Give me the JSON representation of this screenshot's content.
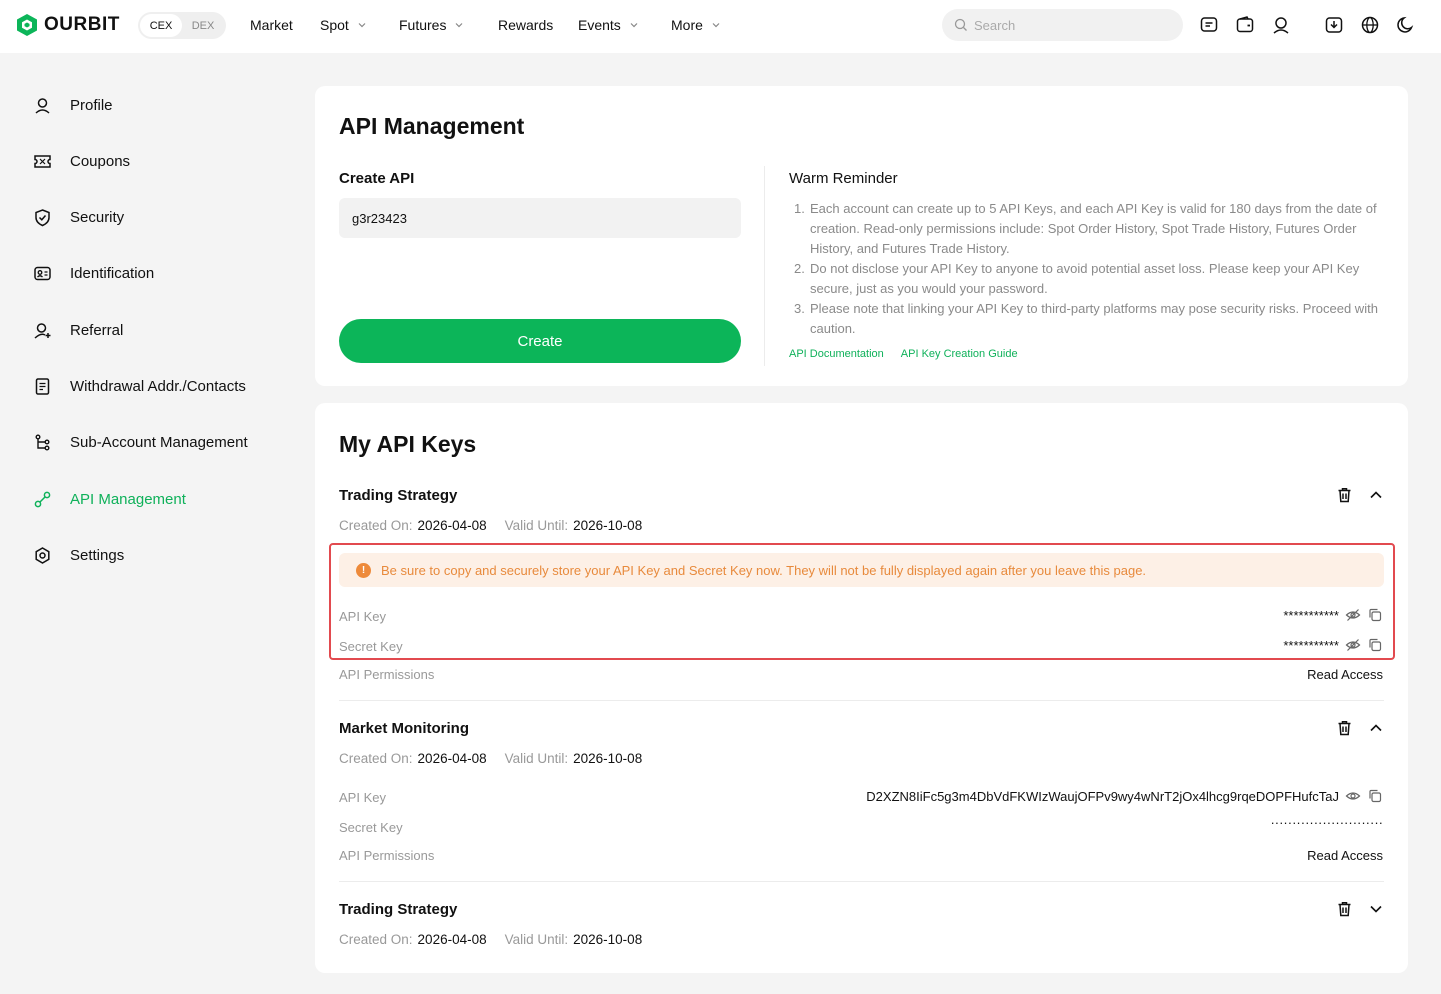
{
  "topbar": {
    "brand": "OURBIT",
    "segments": [
      "CEX",
      "DEX"
    ],
    "nav": [
      "Market",
      "Spot",
      "Futures",
      "Rewards",
      "Events",
      "More"
    ],
    "search_placeholder": "Search"
  },
  "sidebar": {
    "items": [
      {
        "label": "Profile",
        "icon": "user-icon"
      },
      {
        "label": "Coupons",
        "icon": "coupon-icon"
      },
      {
        "label": "Security",
        "icon": "shield-icon"
      },
      {
        "label": "Identification",
        "icon": "id-card-icon"
      },
      {
        "label": "Referral",
        "icon": "user-plus-icon"
      },
      {
        "label": "Withdrawal Addr./Contacts",
        "icon": "document-icon"
      },
      {
        "label": "Sub-Account Management",
        "icon": "branch-icon"
      },
      {
        "label": "API Management",
        "icon": "link-icon"
      },
      {
        "label": "Settings",
        "icon": "settings-icon"
      }
    ],
    "active": "API Management"
  },
  "api": {
    "title": "API Management",
    "create_label": "Create API",
    "create_value": "g3r23423",
    "create_button": "Create",
    "reminder_title": "Warm Reminder",
    "reminders": [
      {
        "num": "1.",
        "text": "Each account can create up to 5 API Keys, and each API Key is valid for 180 days from the date of creation. Read-only permissions include: Spot Order History, Spot Trade History, Futures Order History, and Futures Trade History."
      },
      {
        "num": "2.",
        "text": "Do not disclose your API Key to anyone to avoid potential asset loss. Please keep your API Key secure, just as you would your password."
      },
      {
        "num": "3.",
        "text": "Please note that linking your API Key to third-party platforms may pose security risks. Proceed with caution."
      }
    ],
    "link_docs": "API Documentation",
    "link_guide": "API Key Creation Guide"
  },
  "keys": {
    "title": "My API Keys",
    "created_label": "Created On:",
    "valid_label": "Valid Until:",
    "api_key_label": "API Key",
    "secret_key_label": "Secret Key",
    "permissions_label": "API Permissions",
    "warning": "Be sure to copy and securely store your API Key and Secret Key now. They will not be fully displayed again after you leave this page.",
    "list": [
      {
        "name": "Trading Strategy",
        "created": "2026-04-08",
        "valid": "2026-10-08",
        "api_key": "***********",
        "secret_key": "***********",
        "permissions": "Read Access"
      },
      {
        "name": "Market Monitoring",
        "created": "2026-04-08",
        "valid": "2026-10-08",
        "api_key": "D2XZN8IiFc5g3m4DbVdFKWIzWaujOFPv9wy4wNrT2jOx4lhcg9rqeDOPFHufcTaJ",
        "secret_key": "··························",
        "permissions": "Read Access"
      },
      {
        "name": "Trading Strategy",
        "created": "2026-04-08",
        "valid": "2026-10-08"
      }
    ]
  },
  "colors": {
    "accent": "#0cb559",
    "warning": "#ee8a3a",
    "highlight": "#e24a4f"
  }
}
